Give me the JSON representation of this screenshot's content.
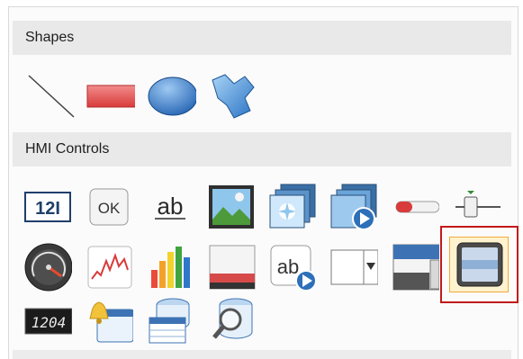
{
  "sections": {
    "shapes": {
      "title": "Shapes"
    },
    "hmi_controls": {
      "title": "HMI Controls"
    }
  },
  "shapes_tools": [
    {
      "icon": "line-icon"
    },
    {
      "icon": "rectangle-icon"
    },
    {
      "icon": "ellipse-icon"
    },
    {
      "icon": "polygon-icon"
    }
  ],
  "hmi_tools": {
    "row1": [
      {
        "icon": "numeric-display-icon",
        "text": "12I"
      },
      {
        "icon": "ok-button-icon",
        "text": "OK"
      },
      {
        "icon": "text-label-icon",
        "text": "ab"
      },
      {
        "icon": "picture-icon"
      },
      {
        "icon": "picture-stack-icon"
      },
      {
        "icon": "animated-picture-icon"
      },
      {
        "icon": "thermometer-icon"
      },
      {
        "icon": "slider-icon"
      }
    ],
    "row2": [
      {
        "icon": "gauge-icon"
      },
      {
        "icon": "trend-chart-icon"
      },
      {
        "icon": "bar-chart-icon"
      },
      {
        "icon": "window-panel-icon"
      },
      {
        "icon": "animated-text-icon",
        "text": "ab"
      },
      {
        "icon": "combobox-icon"
      },
      {
        "icon": "scroll-window-icon"
      },
      {
        "icon": "frame-panel-icon",
        "selected": true
      }
    ],
    "row3": [
      {
        "icon": "digital-display-icon",
        "text": "1204"
      },
      {
        "icon": "alarm-window-icon"
      },
      {
        "icon": "database-grid-icon"
      },
      {
        "icon": "database-search-icon"
      }
    ]
  },
  "colors": {
    "header_bg": "#e9e9e9",
    "selection_border": "#c21a1a",
    "selection_fill": "#fff3cf",
    "selection_inner_border": "#f2a93b"
  }
}
